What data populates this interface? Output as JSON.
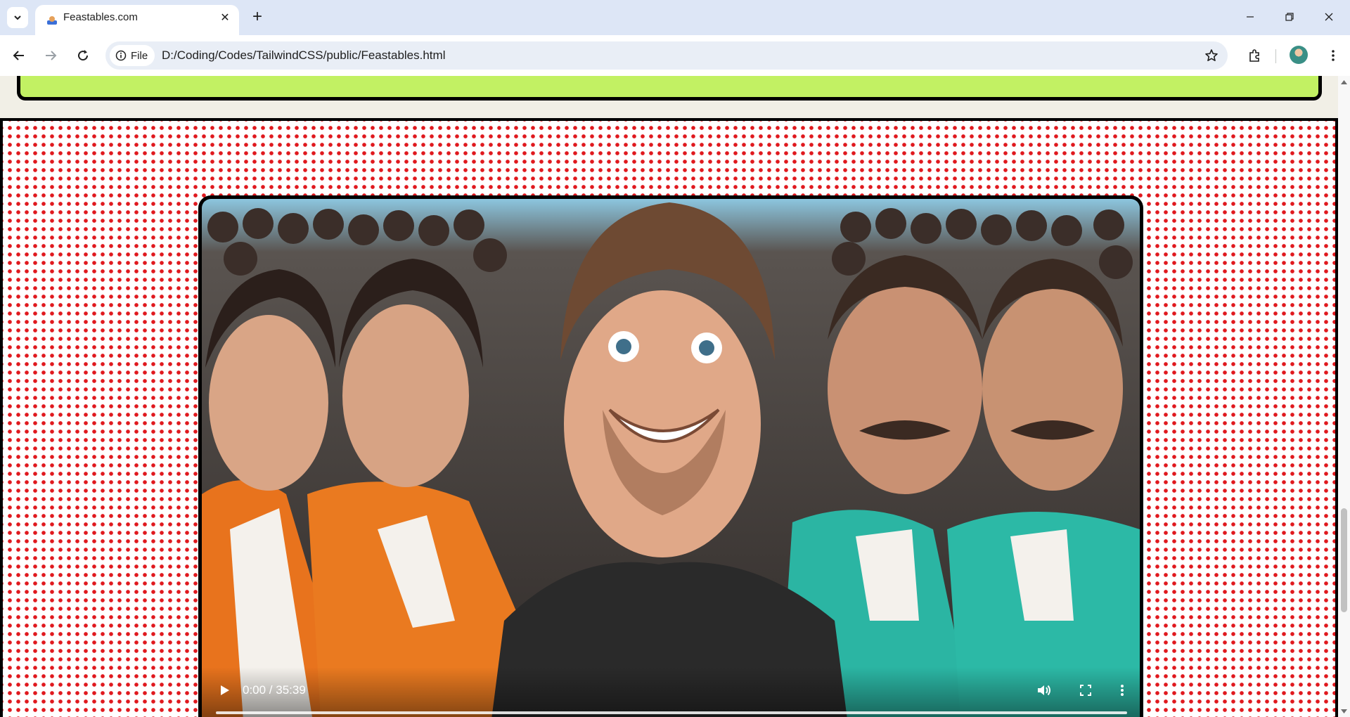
{
  "browser": {
    "tab": {
      "title": "Feastables.com",
      "close_glyph": "✕"
    },
    "new_tab_glyph": "+",
    "address": {
      "scheme_label": "File",
      "url": "D:/Coding/Codes/TailwindCSS/public/Feastables.html"
    },
    "icons": [
      "tab-search-icon",
      "favicon-icon",
      "close-icon",
      "new-tab-icon",
      "minimize-icon",
      "restore-icon",
      "window-close-icon",
      "back-arrow-icon",
      "forward-arrow-icon",
      "reload-icon",
      "info-icon",
      "star-icon",
      "extensions-icon",
      "profile-avatar",
      "more-menu-icon"
    ]
  },
  "page": {
    "banner_color": "#c2f163",
    "dots_color": "#e0191e",
    "video": {
      "time": "0:00 / 35:39",
      "progress": 0.0
    }
  }
}
